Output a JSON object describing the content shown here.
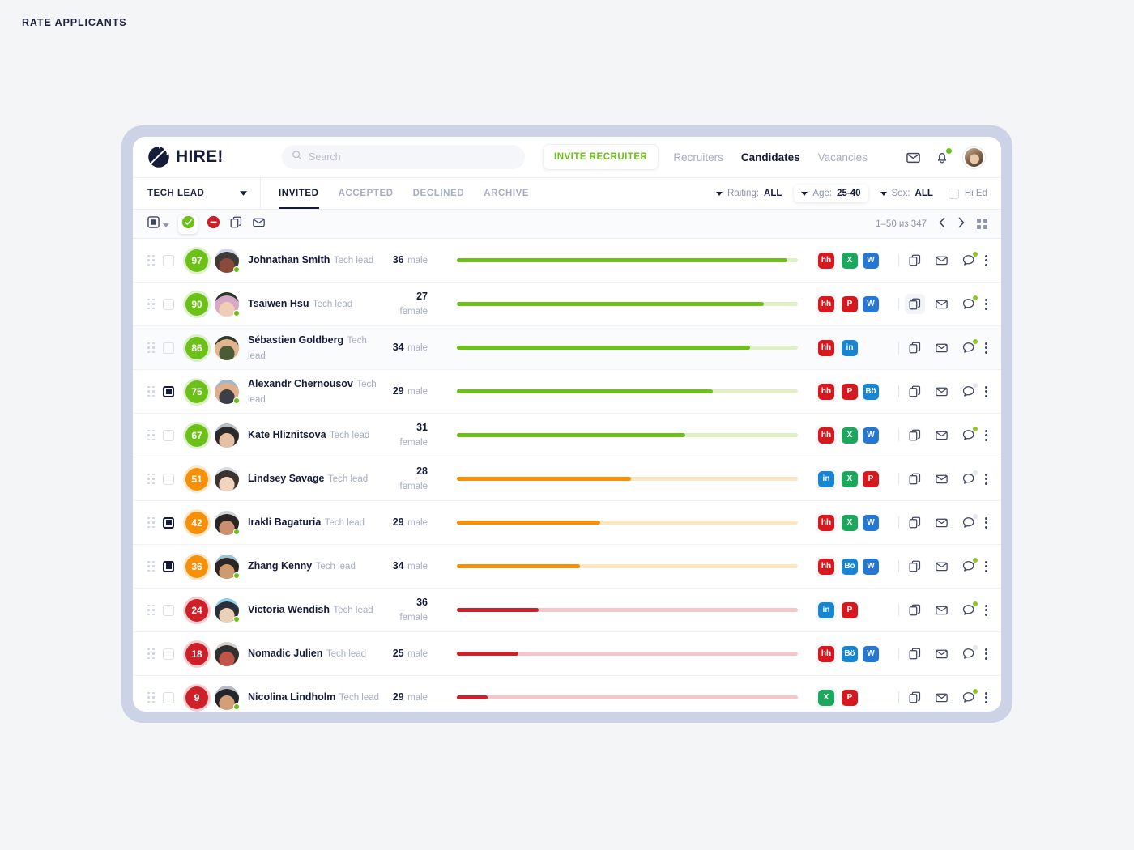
{
  "page_label": "RATE APPLICANTS",
  "brand": {
    "name": "HIRE!",
    "logo_icon": "hire-logo-mark",
    "accent_green": "#6cc118",
    "navy": "#141c3a"
  },
  "search": {
    "placeholder": "Search",
    "value": "",
    "icon": "search-icon"
  },
  "header": {
    "invite_button": "INVITE RECRUITER",
    "nav": [
      {
        "label": "Recruiters",
        "active": false
      },
      {
        "label": "Candidates",
        "active": true
      },
      {
        "label": "Vacancies",
        "active": false
      }
    ],
    "mail_icon": "envelope-icon",
    "bell_icon": "bell-icon",
    "bell_badge": true,
    "avatar": "user-avatar"
  },
  "filterbar": {
    "vacancy": "TECH LEAD",
    "tabs": [
      {
        "label": "INVITED",
        "active": true
      },
      {
        "label": "ACCEPTED",
        "active": false
      },
      {
        "label": "DECLINED",
        "active": false
      },
      {
        "label": "ARCHIVE",
        "active": false
      }
    ],
    "filters": [
      {
        "label": "Raiting:",
        "value": "ALL",
        "boxed": false
      },
      {
        "label": "Age:",
        "value": "25-40",
        "boxed": true
      },
      {
        "label": "Sex:",
        "value": "ALL",
        "boxed": false
      }
    ],
    "hi_ed": {
      "label": "Hi Ed",
      "checked": false
    }
  },
  "toolbar": {
    "select_all_icon": "select-all-checkbox-icon",
    "dropdown_icon": "chevron-down-icon",
    "approve_icon": "check-circle-icon",
    "reject_icon": "minus-circle-icon",
    "copy_icon": "copy-icon",
    "mail_icon": "envelope-icon",
    "pagination": "1–50 из 347",
    "prev_icon": "chevron-left-icon",
    "next_icon": "chevron-right-icon",
    "grid_view_icon": "grid-view-icon"
  },
  "colors": {
    "green": "#6cc118",
    "green_track": "#dff0c6",
    "orange": "#f79009",
    "orange_track": "#fde7c2",
    "red": "#ce2029",
    "red_track": "#f4c6c8",
    "chat_dot_on": "#8ac926",
    "chat_dot_off": "#e3e7f0"
  },
  "candidates": [
    {
      "score": 97,
      "tone": "green",
      "name": "Johnathan Smith",
      "position": "Tech lead",
      "age": 36,
      "sex": "male",
      "selected": false,
      "online": true,
      "avatar_colors": [
        "#cfd6e6",
        "#3f3b39",
        "#8a4a3a"
      ],
      "sources": [
        "hh",
        "X",
        "W"
      ],
      "chat_unread": true,
      "copy_active": false,
      "shaded": false
    },
    {
      "score": 90,
      "tone": "green",
      "name": "Tsaiwen Hsu",
      "position": "Tech lead",
      "age": 27,
      "sex": "female",
      "selected": false,
      "online": true,
      "avatar_colors": [
        "#2c3a2e",
        "#d9a8c4",
        "#f0cdb6"
      ],
      "sources": [
        "hh",
        "P",
        "W"
      ],
      "chat_unread": true,
      "copy_active": true,
      "shaded": false
    },
    {
      "score": 86,
      "tone": "green",
      "name": "Sébastien Goldberg",
      "position": "Tech lead",
      "age": 34,
      "sex": "male",
      "selected": false,
      "online": false,
      "avatar_colors": [
        "#2f3a2a",
        "#e3b48d",
        "#4a5b38"
      ],
      "sources": [
        "hh",
        "in"
      ],
      "chat_unread": true,
      "copy_active": false,
      "shaded": true
    },
    {
      "score": 75,
      "tone": "green",
      "name": "Alexandr Chernousov",
      "position": "Tech lead",
      "age": 29,
      "sex": "male",
      "selected": true,
      "online": true,
      "avatar_colors": [
        "#9fb7cf",
        "#e0b08a",
        "#3a3f48"
      ],
      "sources": [
        "hh",
        "P",
        "Bö"
      ],
      "chat_unread": false,
      "copy_active": false,
      "shaded": false
    },
    {
      "score": 67,
      "tone": "green",
      "name": "Kate Hliznitsova",
      "position": "Tech lead",
      "age": 31,
      "sex": "female",
      "selected": false,
      "online": false,
      "avatar_colors": [
        "#b9bfc9",
        "#2c2a29",
        "#e6c0a4"
      ],
      "sources": [
        "hh",
        "X",
        "W"
      ],
      "chat_unread": true,
      "copy_active": false,
      "shaded": false
    },
    {
      "score": 51,
      "tone": "orange",
      "name": "Lindsey Savage",
      "position": "Tech lead",
      "age": 28,
      "sex": "female",
      "selected": false,
      "online": false,
      "avatar_colors": [
        "#d9dde4",
        "#3a3330",
        "#f2d3bd"
      ],
      "sources": [
        "in",
        "X",
        "P"
      ],
      "chat_unread": false,
      "copy_active": false,
      "shaded": false
    },
    {
      "score": 42,
      "tone": "orange",
      "name": "Irakli Bagaturia",
      "position": "Tech lead",
      "age": 29,
      "sex": "male",
      "selected": true,
      "online": true,
      "avatar_colors": [
        "#cfd4da",
        "#2b2623",
        "#c98f6e"
      ],
      "sources": [
        "hh",
        "X",
        "W"
      ],
      "chat_unread": false,
      "copy_active": false,
      "shaded": false
    },
    {
      "score": 36,
      "tone": "orange",
      "name": "Zhang Kenny",
      "position": "Tech lead",
      "age": 34,
      "sex": "male",
      "selected": true,
      "online": true,
      "avatar_colors": [
        "#9ac3cf",
        "#2a2724",
        "#cf9a6e"
      ],
      "sources": [
        "hh",
        "Bö",
        "W"
      ],
      "chat_unread": true,
      "copy_active": false,
      "shaded": false
    },
    {
      "score": 24,
      "tone": "red",
      "name": "Victoria Wendish",
      "position": "Tech lead",
      "age": 36,
      "sex": "female",
      "selected": false,
      "online": true,
      "avatar_colors": [
        "#8fd2ef",
        "#2b2f3a",
        "#e9d0b6"
      ],
      "sources": [
        "in",
        "P"
      ],
      "chat_unread": true,
      "copy_active": false,
      "shaded": false
    },
    {
      "score": 18,
      "tone": "red",
      "name": "Nomadic Julien",
      "position": "Tech lead",
      "age": 25,
      "sex": "male",
      "selected": false,
      "online": false,
      "avatar_colors": [
        "#d7cfc4",
        "#31302e",
        "#c0564a"
      ],
      "sources": [
        "hh",
        "Bö",
        "W"
      ],
      "chat_unread": false,
      "copy_active": false,
      "shaded": false
    },
    {
      "score": 9,
      "tone": "red",
      "name": "Nicolina Lindholm",
      "position": "Tech lead",
      "age": 29,
      "sex": "male",
      "selected": false,
      "online": true,
      "avatar_colors": [
        "#b6bcc6",
        "#24252a",
        "#d39f78"
      ],
      "sources": [
        "X",
        "P"
      ],
      "chat_unread": true,
      "copy_active": false,
      "shaded": false
    }
  ],
  "source_styles": {
    "hh": {
      "label": "hh",
      "bg": "#d6191f"
    },
    "X": {
      "label": "X",
      "bg": "#1ca85c"
    },
    "W": {
      "label": "W",
      "bg": "#2577d4"
    },
    "P": {
      "label": "P",
      "bg": "#d6191f"
    },
    "in": {
      "label": "in",
      "bg": "#1785d1"
    },
    "Bö": {
      "label": "Bö",
      "bg": "#1785d1"
    }
  }
}
